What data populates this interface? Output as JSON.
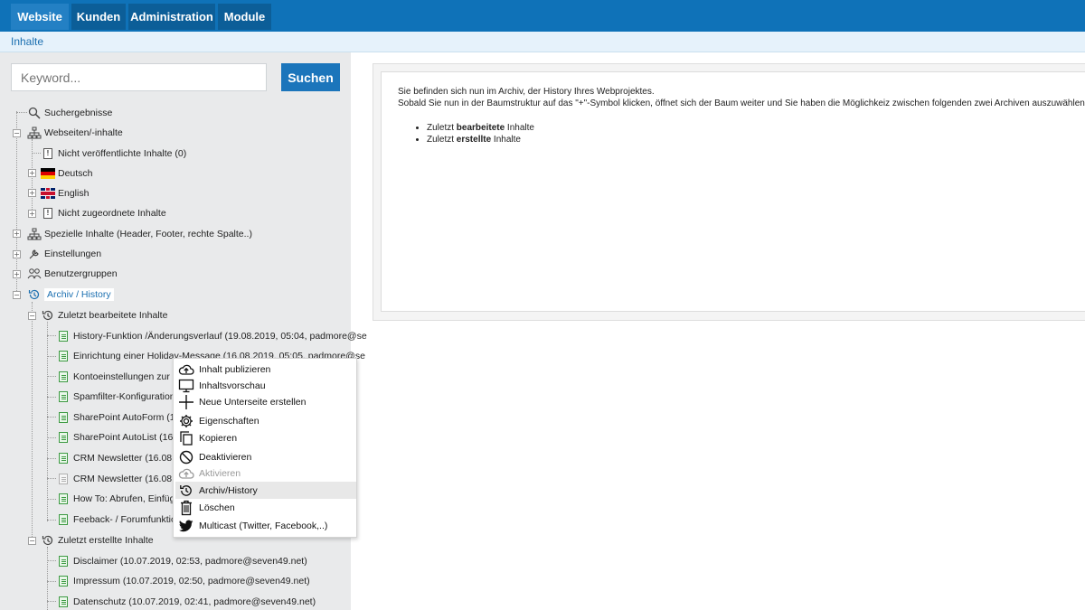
{
  "nav": {
    "tabs": [
      {
        "label": "Website",
        "active": true
      },
      {
        "label": "Kunden",
        "active": false
      },
      {
        "label": "Administration",
        "active": false
      },
      {
        "label": "Module",
        "active": false
      }
    ]
  },
  "breadcrumb": "Inhalte",
  "search": {
    "placeholder": "Keyword...",
    "button_label": "Suchen"
  },
  "tree": {
    "suchergebnisse": "Suchergebnisse",
    "webseiten": "Webseiten/-inhalte",
    "nicht_veroeffentlicht": "Nicht veröffentlichte Inhalte (0)",
    "deutsch": "Deutsch",
    "english": "English",
    "nicht_zugeordnet": "Nicht zugeordnete Inhalte",
    "spezielle": "Spezielle Inhalte (Header, Footer, rechte Spalte..)",
    "einstellungen": "Einstellungen",
    "benutzergruppen": "Benutzergruppen",
    "archiv": "Archiv / History",
    "zuletzt_bearbeitet": "Zuletzt bearbeitete Inhalte",
    "bearbeitet_items": [
      "History-Funktion /Änderungsverlauf (19.08.2019, 05:04, padmore@se",
      "Einrichtung einer Holiday-Message (16.08.2019, 05:05, padmore@se",
      "Kontoeinstellungen zur Spe",
      "Spamfilter-Konfiguration P",
      "SharePoint AutoForm (16.0",
      "SharePoint AutoList (16.08",
      "CRM Newsletter (16.08.20",
      "CRM Newsletter (16.08.20",
      "How To: Abrufen, Einfüge",
      "Feeback- / Forumfunktion |"
    ],
    "zuletzt_erstellt": "Zuletzt erstellte Inhalte",
    "erstellt_items": [
      "Disclaimer (10.07.2019, 02:53, padmore@seven49.net)",
      "Impressum (10.07.2019, 02:50, padmore@seven49.net)",
      "Datenschutz (10.07.2019, 02:41, padmore@seven49.net)"
    ]
  },
  "content": {
    "line1": "Sie befinden sich nun im Archiv, der History Ihres Webprojektes.",
    "line2": "Sobald Sie nun in der Baumstruktur auf das \"+\"-Symbol klicken, öffnet sich der Baum weiter und Sie haben die Möglichkeiz zwischen folgenden zwei Archiven auszuwählen:",
    "bullet1_pre": "Zuletzt ",
    "bullet1_bold": "bearbeitete",
    "bullet1_post": " Inhalte",
    "bullet2_pre": "Zuletzt ",
    "bullet2_bold": "erstellte",
    "bullet2_post": " Inhalte"
  },
  "context_menu": {
    "items": [
      {
        "label": "Inhalt publizieren",
        "icon": "cloud-upload-icon"
      },
      {
        "label": "Inhaltsvorschau",
        "icon": "monitor-icon"
      },
      {
        "label": "Neue Unterseite erstellen",
        "icon": "plus-icon"
      },
      {
        "label": "Eigenschaften",
        "icon": "gear-icon"
      },
      {
        "label": "Kopieren",
        "icon": "copy-icon"
      },
      {
        "label": "Deaktivieren",
        "icon": "ban-icon"
      },
      {
        "label": "Aktivieren",
        "icon": "cloud-upload-icon",
        "disabled": true
      },
      {
        "label": "Archiv/History",
        "icon": "history-icon",
        "highlighted": true
      },
      {
        "label": "Löschen",
        "icon": "trash-icon"
      },
      {
        "label": "Multicast (Twitter, Facebook,..)",
        "icon": "twitter-icon"
      }
    ]
  },
  "colors": {
    "nav_bg": "#0f72b8",
    "accent": "#1b75bb",
    "doc_green": "#3d9a43"
  }
}
